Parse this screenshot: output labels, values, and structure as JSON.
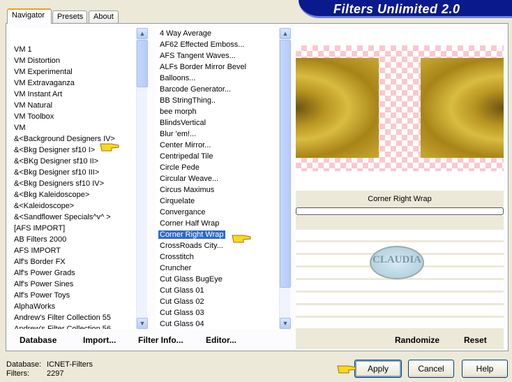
{
  "title": "Filters Unlimited 2.0",
  "tabs": [
    {
      "label": "Navigator",
      "active": true
    },
    {
      "label": "Presets"
    },
    {
      "label": "About"
    }
  ],
  "categories": [
    "",
    "VM 1",
    "VM Distortion",
    "VM Experimental",
    "VM Extravaganza",
    "VM Instant Art",
    "VM Natural",
    "VM Toolbox",
    "VM",
    "&<Background Designers IV>",
    "&<Bkg Designer sf10 I>",
    "&<BKg Designer sf10 II>",
    "&<Bkg Designer sf10 III>",
    "&<Bkg Designers sf10 IV>",
    "&<Bkg Kaleidoscope>",
    "&<Kaleidoscope>",
    "&<Sandflower Specials^v^ >",
    "[AFS IMPORT]",
    "AB Filters 2000",
    "AFS IMPORT",
    "Alf's Border FX",
    "Alf's Power Grads",
    "Alf's Power Sines",
    "Alf's Power Toys",
    "AlphaWorks",
    "Andrew's Filter Collection 55",
    "Andrew's Filter Collection 56"
  ],
  "filters": [
    "4 Way Average",
    "AF62 Effected Emboss...",
    "AFS Tangent Waves...",
    "ALFs Border Mirror Bevel",
    "Balloons...",
    "Barcode Generator...",
    "BB StringThing..",
    "bee morph",
    "BlindsVertical",
    "Blur 'em!...",
    "Center Mirror...",
    "Centripedal Tile",
    "Circle Pede",
    "Circular Weave...",
    "Circus Maximus",
    "Cirquelate",
    "Convergance",
    "Corner Half Wrap",
    "Corner Right Wrap",
    "CrossRoads City...",
    "Crosstitch",
    "Cruncher",
    "Cut Glass  BugEye",
    "Cut Glass 01",
    "Cut Glass 02",
    "Cut Glass 03",
    "Cut Glass 04"
  ],
  "selected_category": "&<Bkg Designer sf10 I>",
  "selected_filter": "Corner Right Wrap",
  "preview": {
    "filter_name": "Corner Right Wrap",
    "logo_text": "CLAUDIA"
  },
  "toolbar": {
    "database": "Database",
    "import": "Import...",
    "filter_info": "Filter Info...",
    "editor": "Editor...",
    "randomize": "Randomize",
    "reset": "Reset"
  },
  "status": {
    "database_label": "Database:",
    "database_value": "ICNET-Filters",
    "filters_label": "Filters:",
    "filters_value": "2297"
  },
  "buttons": {
    "apply": "Apply",
    "cancel": "Cancel",
    "help": "Help"
  },
  "colors": {
    "selection": "#316ac5",
    "banner": "#0a1a8c",
    "background": "#ece9d8"
  }
}
